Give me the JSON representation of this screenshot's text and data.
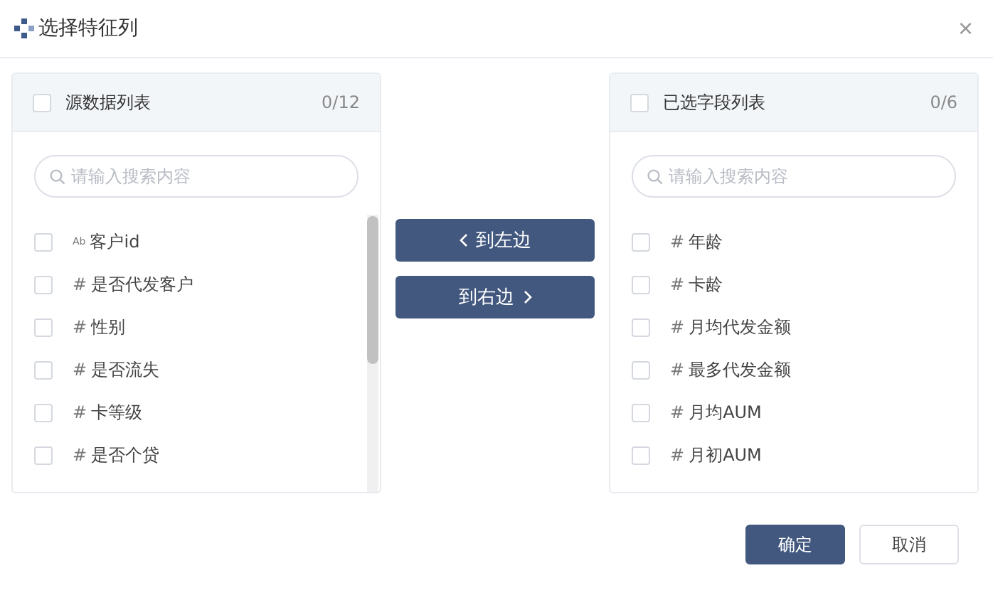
{
  "dialog": {
    "title": "选择特征列",
    "close": "×"
  },
  "source_panel": {
    "title": "源数据列表",
    "checked": false,
    "count": "0/12",
    "search": {
      "placeholder": "请输入搜索内容"
    },
    "items": [
      {
        "type_mark": "Ab",
        "label": "客户id",
        "checked": false
      },
      {
        "type_mark": "#",
        "label": "是否代发客户",
        "checked": false
      },
      {
        "type_mark": "#",
        "label": "性别",
        "checked": false
      },
      {
        "type_mark": "#",
        "label": "是否流失",
        "checked": false
      },
      {
        "type_mark": "#",
        "label": "卡等级",
        "checked": false
      },
      {
        "type_mark": "#",
        "label": "是否个贷",
        "checked": false
      }
    ]
  },
  "transfer_buttons": [
    {
      "label": "到左边",
      "kind": "left"
    },
    {
      "label": "到右边",
      "kind": "right"
    }
  ],
  "target_panel": {
    "title": "已选字段列表",
    "checked": false,
    "count": "0/6",
    "search": {
      "placeholder": "请输入搜索内容"
    },
    "items": [
      {
        "type_mark": "#",
        "label": "年龄",
        "checked": false
      },
      {
        "type_mark": "#",
        "label": "卡龄",
        "checked": false
      },
      {
        "type_mark": "#",
        "label": "月均代发金额",
        "checked": false
      },
      {
        "type_mark": "#",
        "label": "最多代发金额",
        "checked": false
      },
      {
        "type_mark": "#",
        "label": "月均AUM",
        "checked": false
      },
      {
        "type_mark": "#",
        "label": "月初AUM",
        "checked": false
      }
    ]
  },
  "footer_buttons": [
    {
      "label": "确定",
      "primary": true
    },
    {
      "label": "取消",
      "primary": false
    }
  ]
}
